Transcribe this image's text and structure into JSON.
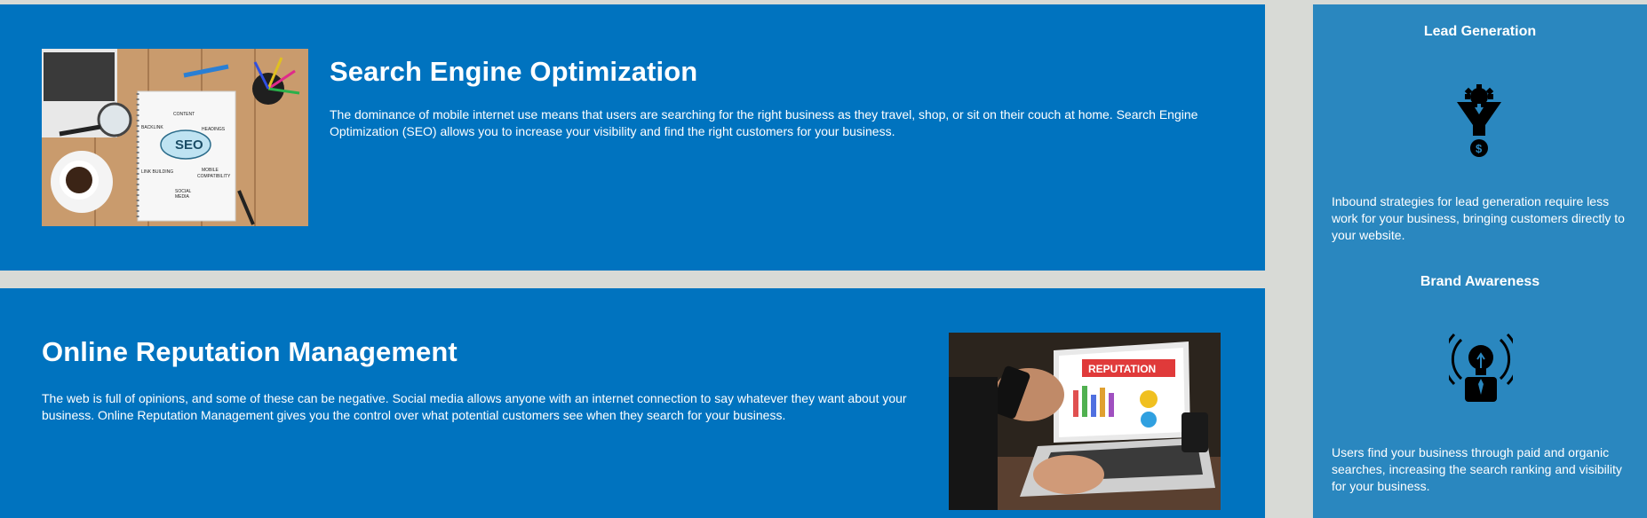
{
  "seo": {
    "title": "Search Engine Optimization",
    "text": "The dominance of mobile internet use means that users are searching for the right business as they travel, shop, or sit on their couch at home. Search Engine Optimization (SEO) allows you to increase your visibility and find the right customers for your business.",
    "photo_labels": {
      "seo": "SEO",
      "content": "CONTENT",
      "backlink": "BACKLINK",
      "headings": "HEADINGS",
      "link_building": "LINK BUILDING",
      "mobile": "MOBILE",
      "compatibility": "COMPATIBILITY",
      "social": "SOCIAL",
      "media": "MEDIA"
    }
  },
  "orm": {
    "title": "Online Reputation Management",
    "text": "The web is full of opinions, and some of these can be negative. Social media allows anyone with an internet connection to say whatever they want about your business. Online Reputation Management gives you the control over what potential customers see when they search for your business.",
    "photo_label": "REPUTATION"
  },
  "sidebar": {
    "lead_generation": {
      "title": "Lead Generation",
      "icon": "gear-funnel-dollar-icon",
      "text": "Inbound strategies for lead generation require less work for your business, bringing customers directly to your website."
    },
    "brand_awareness": {
      "title": "Brand Awareness",
      "icon": "lightbulb-broadcast-icon",
      "text": "Users find your business through paid and organic searches, increasing the search ranking and visibility for your business."
    }
  },
  "colors": {
    "panel_blue": "#0073bf",
    "sidebar_blue": "#2a87bf",
    "page_gray": "#d8dad6",
    "text": "#ffffff",
    "reputation_red": "#e03a3a"
  }
}
